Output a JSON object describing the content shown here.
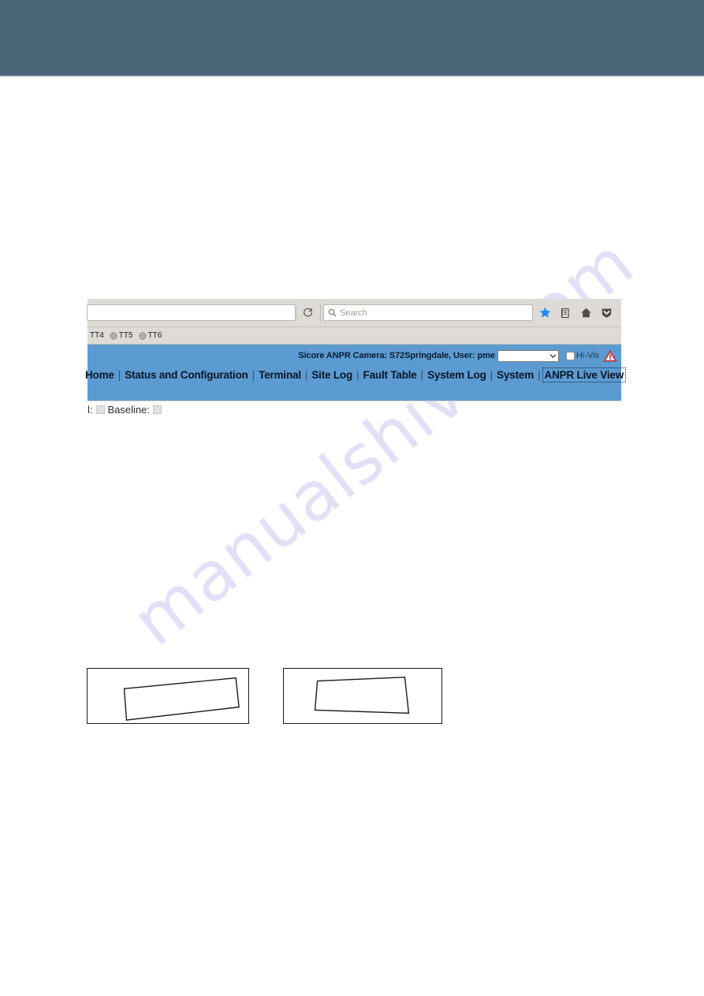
{
  "page": {
    "banner_color": "#4b6678",
    "background_color": "#ffffff",
    "watermark": "manualshive.com"
  },
  "browser": {
    "toolbar": {
      "url_value": "",
      "url_placeholder": "",
      "reload_icon": "reload-icon",
      "search_placeholder": "Search",
      "search_icon": "search-icon",
      "icons": [
        {
          "name": "bookmark-star-icon",
          "label": ""
        },
        {
          "name": "library-icon",
          "label": ""
        },
        {
          "name": "home-icon",
          "label": ""
        },
        {
          "name": "pocket-shield-icon",
          "label": ""
        }
      ]
    },
    "bookmarks": [
      {
        "label": "TT4",
        "icon": ""
      },
      {
        "label": "TT5",
        "icon": "globe-icon"
      },
      {
        "label": "TT6",
        "icon": "globe-icon"
      }
    ]
  },
  "app": {
    "header": {
      "title": "Sicore ANPR Camera: S72Springdale, User: pme",
      "camera_select_value": "",
      "hivis_label": "Hi-Vis",
      "hivis_checked": false,
      "warning_icon": "warning-triangle-icon",
      "header_color": "#5b9bd1"
    },
    "nav": [
      {
        "label": "Home",
        "focused": false
      },
      {
        "label": "Status and Configuration",
        "focused": false
      },
      {
        "label": "Terminal",
        "focused": false
      },
      {
        "label": "Site Log",
        "focused": false
      },
      {
        "label": "Fault Table",
        "focused": false
      },
      {
        "label": "System Log",
        "focused": false
      },
      {
        "label": "System",
        "focused": false
      },
      {
        "label": "ANPR Live View",
        "focused": true
      }
    ],
    "nav_separator": "|"
  },
  "clipped_row": {
    "prefix_text": "l:",
    "middle_label": "Baseline:"
  },
  "figures": [
    {
      "name": "plate-orientation-left",
      "caption": ""
    },
    {
      "name": "plate-orientation-right",
      "caption": ""
    }
  ]
}
